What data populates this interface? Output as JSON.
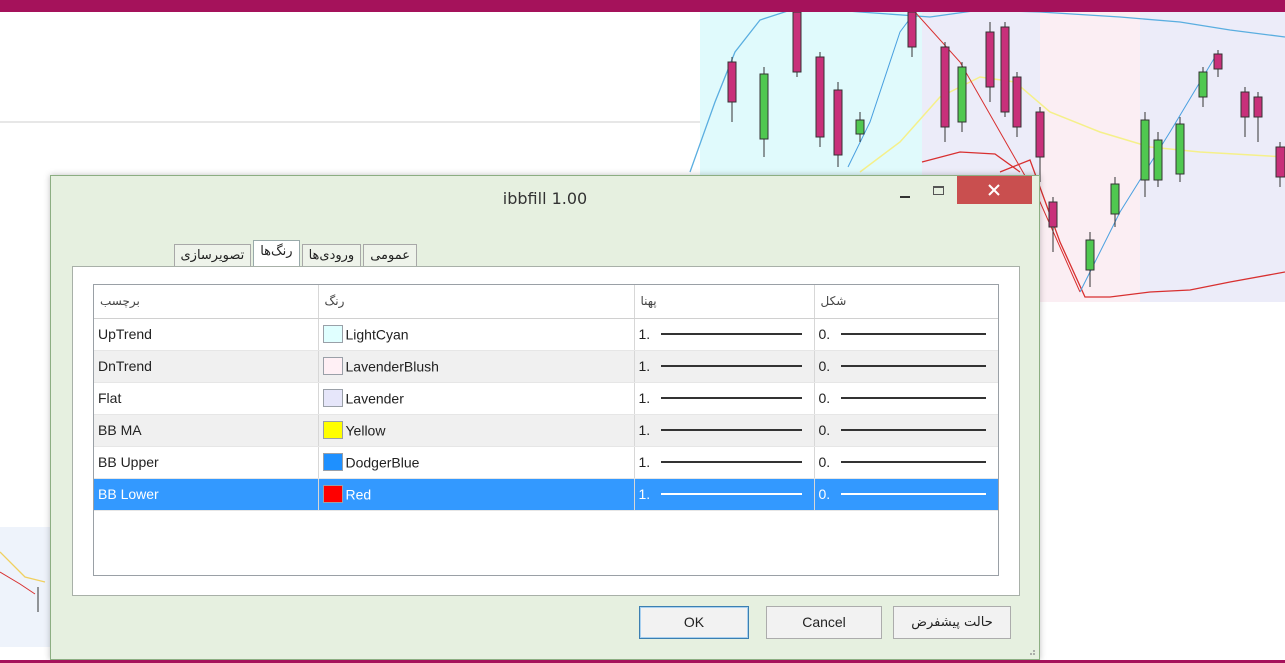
{
  "dialog": {
    "title": "ibbfill 1.00",
    "tabs": [
      {
        "label": "عمومی",
        "active": false
      },
      {
        "label": "ورودی‌ها",
        "active": false
      },
      {
        "label": "رنگ‌ها",
        "active": true
      },
      {
        "label": "تصویرسازی",
        "active": false
      }
    ],
    "table": {
      "headers": [
        "برچسب",
        "رنگ",
        "پهنا",
        "شکل"
      ],
      "rows": [
        {
          "label": "UpTrend",
          "color_name": "LightCyan",
          "color": "#e0ffff",
          "width": "1.",
          "style": "0."
        },
        {
          "label": "DnTrend",
          "color_name": "LavenderBlush",
          "color": "#fff0f5",
          "width": "1.",
          "style": "0."
        },
        {
          "label": "Flat",
          "color_name": "Lavender",
          "color": "#e6e6fa",
          "width": "1.",
          "style": "0."
        },
        {
          "label": "BB MA",
          "color_name": "Yellow",
          "color": "#ffff00",
          "width": "1.",
          "style": "0."
        },
        {
          "label": "BB Upper",
          "color_name": "DodgerBlue",
          "color": "#1e90ff",
          "width": "1.",
          "style": "0."
        },
        {
          "label": "BB Lower",
          "color_name": "Red",
          "color": "#ff0000",
          "width": "1.",
          "style": "0.",
          "selected": true
        }
      ]
    },
    "buttons": {
      "ok": "OK",
      "cancel": "Cancel",
      "defaults": "حالت پیشفرض"
    }
  },
  "theme": {
    "accent_bar": "#a5125b",
    "dialog_bg": "#e6f0e0",
    "close_button": "#c94f4f",
    "selection": "#3399ff"
  }
}
